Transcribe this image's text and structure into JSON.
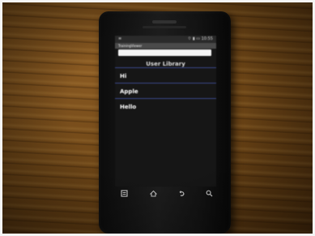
{
  "screen": {
    "status_bar": {
      "left_icon": "notification-icon",
      "time": "10:55",
      "icons": [
        "wifi-icon",
        "signal-icon",
        "battery-icon"
      ]
    },
    "app_title": "TrainingViewer",
    "search": {
      "value": "",
      "placeholder": ""
    },
    "library_header": "User Library",
    "items": [
      {
        "label": "Hi"
      },
      {
        "label": "Apple"
      },
      {
        "label": "Hello"
      }
    ]
  },
  "hardware_keys": {
    "menu_icon": "menu-icon",
    "home_icon": "home-icon",
    "back_icon": "back-icon",
    "search_icon": "search-icon"
  },
  "colors": {
    "divider": "#3a4a8a",
    "screen_bg": "#161616",
    "wood": "#6b4416"
  }
}
